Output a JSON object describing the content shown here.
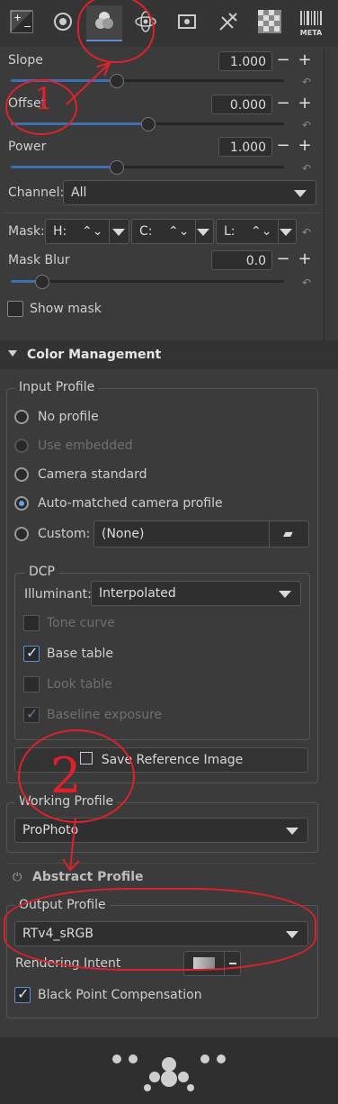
{
  "toolbar": {
    "tabs": [
      {
        "icon": "exposure-icon"
      },
      {
        "icon": "detail-icon"
      },
      {
        "icon": "color-icon"
      },
      {
        "icon": "advanced-icon"
      },
      {
        "icon": "transform-icon"
      },
      {
        "icon": "raw-icon"
      },
      {
        "icon": "checkerboard-icon"
      },
      {
        "icon": "meta-icon",
        "label": "META"
      }
    ],
    "active_tab": 2
  },
  "cdl": {
    "slope": {
      "label": "Slope",
      "value": "1.000",
      "position": 0.3
    },
    "offset": {
      "label": "Offset",
      "value": "0.000",
      "position": 0.5
    },
    "power": {
      "label": "Power",
      "value": "1.000",
      "position": 0.3
    },
    "channel": {
      "label": "Channel:",
      "value": "All"
    },
    "mask": {
      "label": "Mask:",
      "h": "H:",
      "c": "C:",
      "l": "L:"
    },
    "mask_blur": {
      "label": "Mask Blur",
      "value": "0.0",
      "position": 0.0
    },
    "show_mask": {
      "label": "Show mask",
      "checked": false
    }
  },
  "color_management": {
    "title": "Color Management",
    "input_profile": {
      "title": "Input Profile",
      "options": [
        {
          "label": "No profile",
          "selected": false,
          "enabled": true
        },
        {
          "label": "Use embedded",
          "selected": false,
          "enabled": false
        },
        {
          "label": "Camera standard",
          "selected": false,
          "enabled": true
        },
        {
          "label": "Auto-matched camera profile",
          "selected": true,
          "enabled": true
        },
        {
          "label": "Custom:",
          "selected": false,
          "enabled": true
        }
      ],
      "custom_value": "(None)",
      "dcp": {
        "title": "DCP",
        "illuminant_label": "Illuminant:",
        "illuminant_value": "Interpolated",
        "options": [
          {
            "label": "Tone curve",
            "checked": false,
            "enabled": false
          },
          {
            "label": "Base table",
            "checked": true,
            "enabled": true
          },
          {
            "label": "Look table",
            "checked": false,
            "enabled": false
          },
          {
            "label": "Baseline exposure",
            "checked": true,
            "enabled": false
          }
        ]
      },
      "save_reference": "Save Reference Image"
    },
    "working_profile": {
      "title": "Working Profile",
      "value": "ProPhoto"
    },
    "abstract_profile": {
      "title": "Abstract Profile"
    },
    "output_profile": {
      "title": "Output Profile",
      "value": "RTv4_sRGB",
      "rendering_intent_label": "Rendering Intent",
      "bpc": {
        "label": "Black Point Compensation",
        "checked": true
      }
    }
  },
  "annotations": {
    "one": "1",
    "two": "2"
  },
  "colors": {
    "accent": "#3f6fb0",
    "annotation": "#e0202a",
    "background": "#3b3b3b"
  }
}
